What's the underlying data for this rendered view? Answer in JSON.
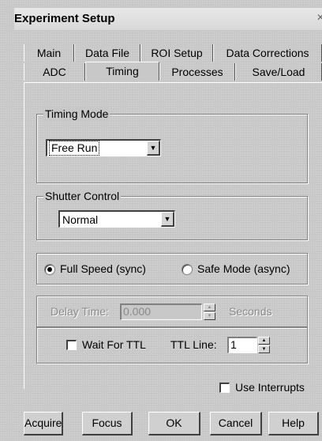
{
  "window": {
    "title": "Experiment Setup",
    "close_glyph": "✕"
  },
  "tabs": {
    "back_row": [
      "Main",
      "Data File",
      "ROI Setup",
      "Data Corrections"
    ],
    "front_row": [
      "ADC",
      "Timing",
      "Processes",
      "Save/Load"
    ],
    "active": "Timing"
  },
  "timing_mode": {
    "label": "Timing Mode",
    "value": "Free Run"
  },
  "shutter_control": {
    "label": "Shutter Control",
    "value": "Normal"
  },
  "speed": {
    "full_speed_label": "Full Speed (sync)",
    "safe_mode_label": "Safe Mode (async)",
    "selected": "Full Speed (sync)"
  },
  "delay": {
    "label": "Delay Time:",
    "value": "0.000",
    "units": "Seconds"
  },
  "ttl": {
    "wait_label": "Wait For TTL",
    "wait_checked": false,
    "line_label": "TTL Line:",
    "line_value": "1"
  },
  "interrupts": {
    "label": "Use Interrupts",
    "checked": false
  },
  "buttons": {
    "acquire": "Acquire",
    "focus": "Focus",
    "ok": "OK",
    "cancel": "Cancel",
    "help": "Help"
  },
  "icons": {
    "dropdown_arrow": "▼",
    "spin_up": "▲",
    "spin_down": "▼"
  }
}
